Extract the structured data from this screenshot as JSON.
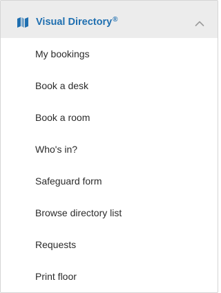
{
  "header": {
    "title": "Visual Directory",
    "trademark": "®",
    "icon": "map-icon",
    "toggle_icon": "chevron-up-icon",
    "accent_color": "#1f6fb0",
    "background_color": "#ececec"
  },
  "menu": {
    "items": [
      {
        "label": "My bookings"
      },
      {
        "label": "Book a desk"
      },
      {
        "label": "Book a room"
      },
      {
        "label": "Who's in?"
      },
      {
        "label": "Safeguard form"
      },
      {
        "label": "Browse directory list"
      },
      {
        "label": "Requests"
      },
      {
        "label": "Print floor"
      }
    ]
  }
}
